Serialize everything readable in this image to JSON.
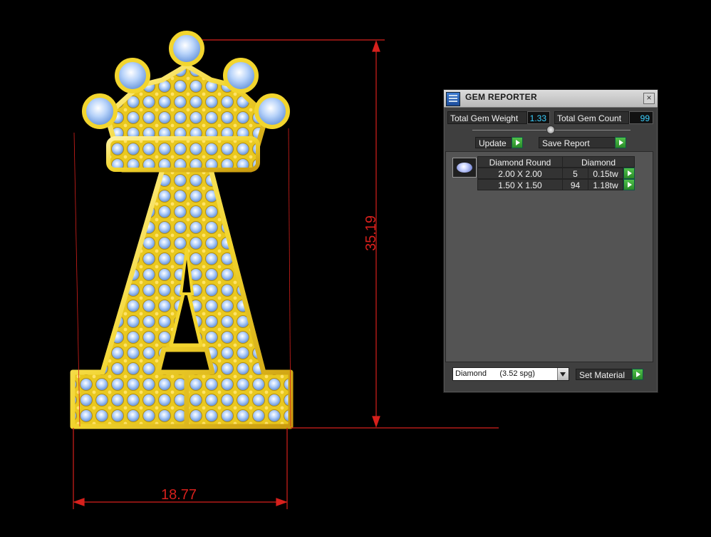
{
  "viewport": {
    "dimensions": {
      "width_value": "18.77",
      "height_value": "35.19"
    },
    "colors": {
      "background": "#000000",
      "dimension_line": "#d6201c",
      "gold": "#f2d52e",
      "stone": "#a9c8f4"
    }
  },
  "gem_reporter": {
    "title": "GEM REPORTER",
    "close_symbol": "×",
    "total_gem_weight_label": "Total Gem Weight",
    "total_gem_weight_value": "1.33",
    "total_gem_count_label": "Total Gem Count",
    "total_gem_count_value": "99",
    "update_label": "Update",
    "save_report_label": "Save Report",
    "table": {
      "headers": [
        "Diamond Round",
        "Diamond"
      ],
      "rows": [
        {
          "size": "2.00 X 2.00",
          "count": "5",
          "weight": "0.15tw"
        },
        {
          "size": "1.50 X 1.50",
          "count": "94",
          "weight": "1.18tw"
        }
      ]
    },
    "material_value": "Diamond      (3.52 spg)",
    "set_material_label": "Set Material",
    "icons": [
      "gem-reporter-app-icon",
      "close-icon",
      "splitter-knob",
      "go-arrow-icon",
      "diamond-thumbnail-icon",
      "chevron-down-icon"
    ]
  }
}
